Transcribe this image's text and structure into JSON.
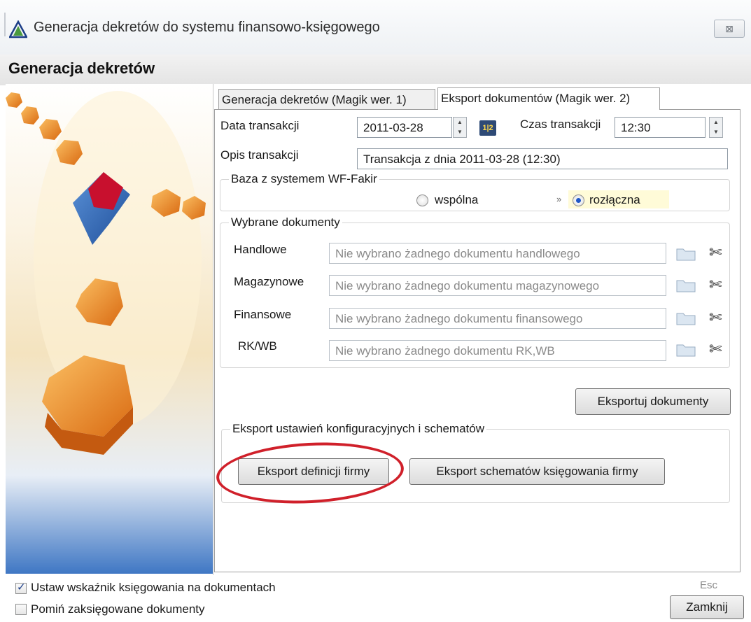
{
  "window": {
    "title": "Generacja dekretów do systemu finansowo-księgowego",
    "close_symbol": "⊠",
    "app_icon": "warning-triangle-icon"
  },
  "header": {
    "title": "Generacja dekretów"
  },
  "tabs": [
    {
      "label": "Generacja dekretów (Magik wer. 1)",
      "active": false
    },
    {
      "label": "Eksport dokumentów (Magik wer. 2)",
      "active": true
    }
  ],
  "form": {
    "date_label": "Data transakcji",
    "date_value": "2011-03-28",
    "calendar_icon_text": "1|2",
    "time_label": "Czas transakcji",
    "time_value": "12:30",
    "desc_label": "Opis transakcji",
    "desc_value": "Transakcja z dnia 2011-03-28 (12:30)"
  },
  "base_group": {
    "legend": "Baza z systemem WF-Fakir",
    "option_shared": "wspólna",
    "option_separate": "rozłączna",
    "selected": "rozłączna",
    "marker": "»"
  },
  "docs_group": {
    "legend": "Wybrane dokumenty",
    "rows": [
      {
        "label": "Handlowe",
        "placeholder": "Nie wybrano żadnego dokumentu handlowego"
      },
      {
        "label": "Magazynowe",
        "placeholder": "Nie wybrano żadnego dokumentu magazynowego"
      },
      {
        "label": "Finansowe",
        "placeholder": "Nie wybrano żadnego dokumentu finansowego"
      },
      {
        "label": "RK/WB",
        "placeholder": "Nie wybrano żadnego dokumentu RK,WB"
      }
    ],
    "scissors_glyph": "✄"
  },
  "export_button": "Eksportuj dokumenty",
  "config_group": {
    "legend": "Eksport ustawień konfiguracyjnych i schematów",
    "btn_definitions": "Eksport definicji firmy",
    "btn_schemes": "Eksport schematów księgowania firmy"
  },
  "footer": {
    "check1_label": "Ustaw wskaźnik księgowania na dokumentach",
    "check1_checked": true,
    "check2_label": "Pomiń zaksięgowane dokumenty",
    "check2_checked": false,
    "esc_hint": "Esc",
    "close_button": "Zamknij"
  },
  "colors": {
    "accent_red": "#d0202a",
    "radio_selected": "#1f57c7",
    "side_orange": "#f0922a",
    "side_blue": "#3f77c4"
  }
}
